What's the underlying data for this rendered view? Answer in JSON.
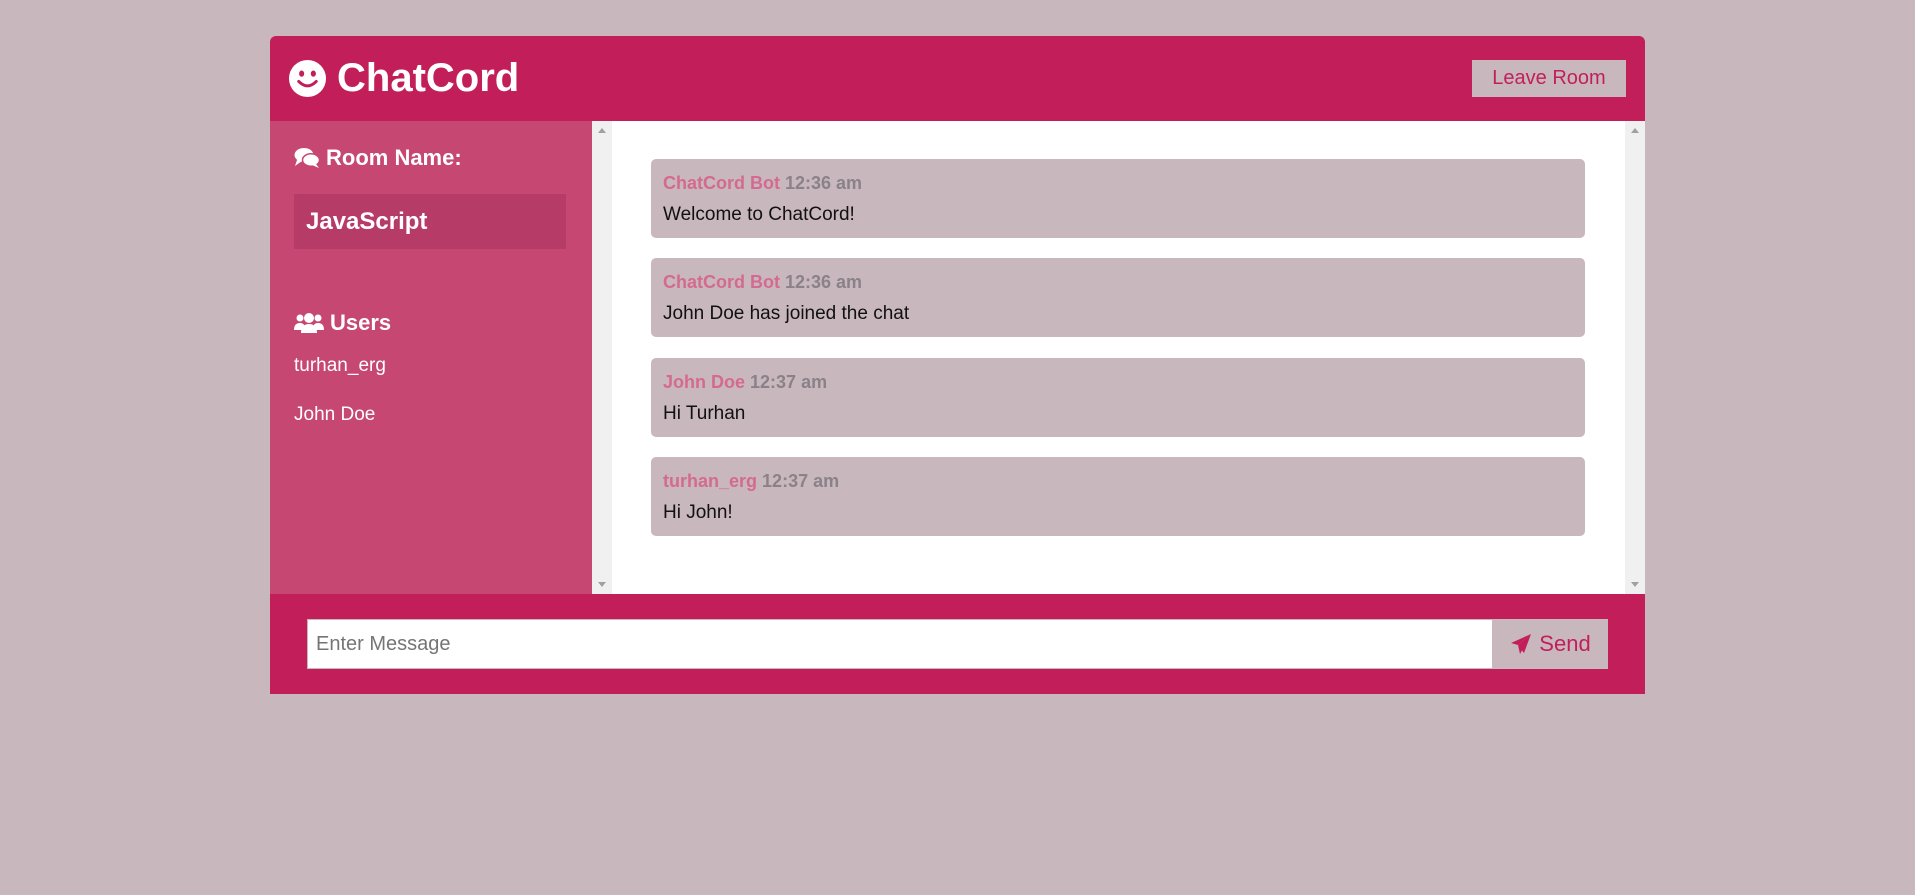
{
  "header": {
    "title": "ChatCord",
    "leave_label": "Leave Room"
  },
  "sidebar": {
    "room_heading": "Room Name:",
    "room_name": "JavaScript",
    "users_heading": "Users",
    "users": [
      "turhan_erg",
      "John Doe"
    ]
  },
  "messages": [
    {
      "user": "ChatCord Bot",
      "time": "12:36 am",
      "text": "Welcome to ChatCord!"
    },
    {
      "user": "ChatCord Bot",
      "time": "12:36 am",
      "text": "John Doe has joined the chat"
    },
    {
      "user": "John Doe",
      "time": "12:37 am",
      "text": "Hi Turhan"
    },
    {
      "user": "turhan_erg",
      "time": "12:37 am",
      "text": "Hi John!"
    }
  ],
  "footer": {
    "input_placeholder": "Enter Message",
    "send_label": "Send"
  },
  "colors": {
    "background": "#c8b8bd",
    "primary": "#c21f5a",
    "sidebar": "#c54772",
    "room_box": "#b63b66",
    "username": "#d46a8f"
  },
  "icons": {
    "brand": "smile-icon",
    "room": "comments-icon",
    "users": "users-icon",
    "send": "paper-plane-icon"
  }
}
